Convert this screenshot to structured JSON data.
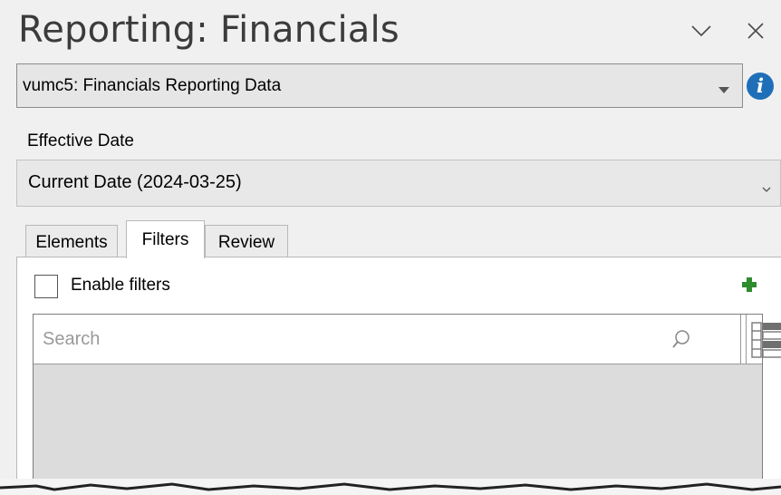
{
  "header": {
    "title": "Reporting: Financials",
    "collapse_icon": "chevron-down-icon",
    "close_icon": "close-icon"
  },
  "source": {
    "selected": "vumc5: Financials Reporting Data",
    "info_icon": "info-icon",
    "info_glyph": "i"
  },
  "effective_date": {
    "label": "Effective Date",
    "selected": "Current Date (2024-03-25)"
  },
  "tabs": [
    {
      "label": "Elements",
      "active": false
    },
    {
      "label": "Filters",
      "active": true
    },
    {
      "label": "Review",
      "active": false
    }
  ],
  "filters": {
    "enable_label": "Enable filters",
    "enabled": false,
    "add_icon": "plus-icon",
    "search_placeholder": "Search",
    "search_value": "",
    "view_icon": "list-view-icon"
  },
  "colors": {
    "accent_blue": "#1f6fb8",
    "add_green": "#2e8b2e"
  }
}
